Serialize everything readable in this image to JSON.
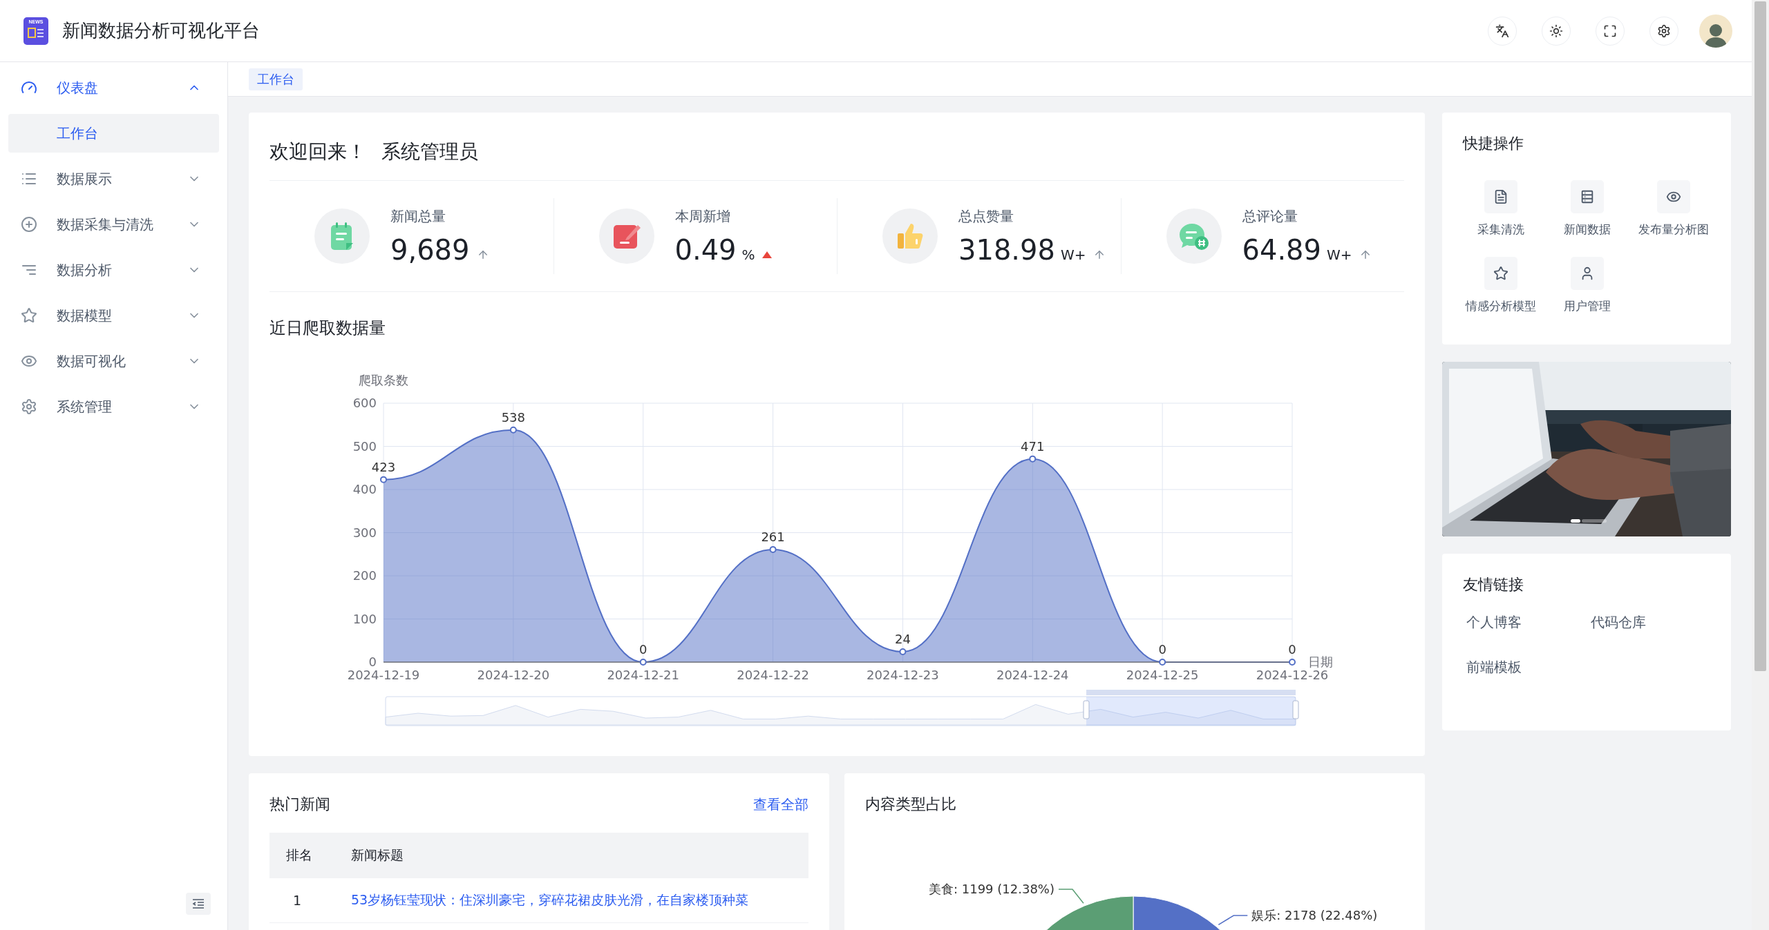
{
  "header": {
    "logo_text": "NEWS",
    "title": "新闻数据分析可视化平台"
  },
  "sidebar": {
    "items": [
      {
        "label": "仪表盘",
        "expanded": true,
        "children": [
          {
            "label": "工作台",
            "selected": true
          }
        ]
      },
      {
        "label": "数据展示",
        "expanded": false
      },
      {
        "label": "数据采集与清洗",
        "expanded": false
      },
      {
        "label": "数据分析",
        "expanded": false
      },
      {
        "label": "数据模型",
        "expanded": false
      },
      {
        "label": "数据可视化",
        "expanded": false
      },
      {
        "label": "系统管理",
        "expanded": false
      }
    ]
  },
  "breadcrumb": {
    "tags": [
      {
        "label": "工作台",
        "selected": true
      }
    ]
  },
  "welcome": {
    "greeting": "欢迎回来！",
    "user": "系统管理员"
  },
  "stats": [
    {
      "label": "新闻总量",
      "value": "9,689",
      "kind": "arrow"
    },
    {
      "label": "本周新增",
      "value": "0.49",
      "unit": "%",
      "kind": "triangle"
    },
    {
      "label": "总点赞量",
      "value": "318.98",
      "unit": "W+",
      "kind": "arrow"
    },
    {
      "label": "总评论量",
      "value": "64.89",
      "unit": "W+",
      "kind": "arrow"
    }
  ],
  "crawl_chart": {
    "title": "近日爬取数据量",
    "chart_data": {
      "type": "area",
      "xlabel": "日期",
      "ylabel": "爬取条数",
      "categories": [
        "2024-12-19",
        "2024-12-20",
        "2024-12-21",
        "2024-12-22",
        "2024-12-23",
        "2024-12-24",
        "2024-12-25",
        "2024-12-26"
      ],
      "series": [
        {
          "color": "#5470c6",
          "values": [
            423,
            538,
            0,
            261,
            24,
            471,
            0,
            0
          ]
        }
      ],
      "ylim": [
        0,
        600
      ],
      "yticks": [
        0,
        100,
        200,
        300,
        400,
        500,
        600
      ],
      "grid": true,
      "data_labels": true
    }
  },
  "quick_actions": {
    "title": "快捷操作",
    "items": [
      {
        "label": "采集清洗"
      },
      {
        "label": "新闻数据"
      },
      {
        "label": "发布量分析图"
      },
      {
        "label": "情感分析模型"
      },
      {
        "label": "用户管理"
      }
    ]
  },
  "carousel": {
    "kind": "picture",
    "indicators": [
      {
        "selected": true
      },
      {
        "selected": false
      }
    ]
  },
  "links": {
    "title": "友情链接",
    "items": [
      "个人博客",
      "代码仓库",
      "前端模板"
    ]
  },
  "hot_news": {
    "title": "热门新闻",
    "more": "查看全部",
    "columns": [
      "排名",
      "新闻标题"
    ],
    "rows": [
      [
        "1",
        "53岁杨钰莹现状：住深圳豪宅，穿碎花裙皮肤光滑，在自家楼顶种菜"
      ]
    ]
  },
  "content_types": {
    "title": "内容类型占比",
    "chart_data": {
      "type": "pie",
      "values": [
        2178,
        1199
      ],
      "colors": [
        "#5470c6",
        "#5b9e74"
      ],
      "value_labels": [
        "娱乐: 2178 (22.48%)",
        "美食: 1199 (12.38%)"
      ]
    }
  }
}
